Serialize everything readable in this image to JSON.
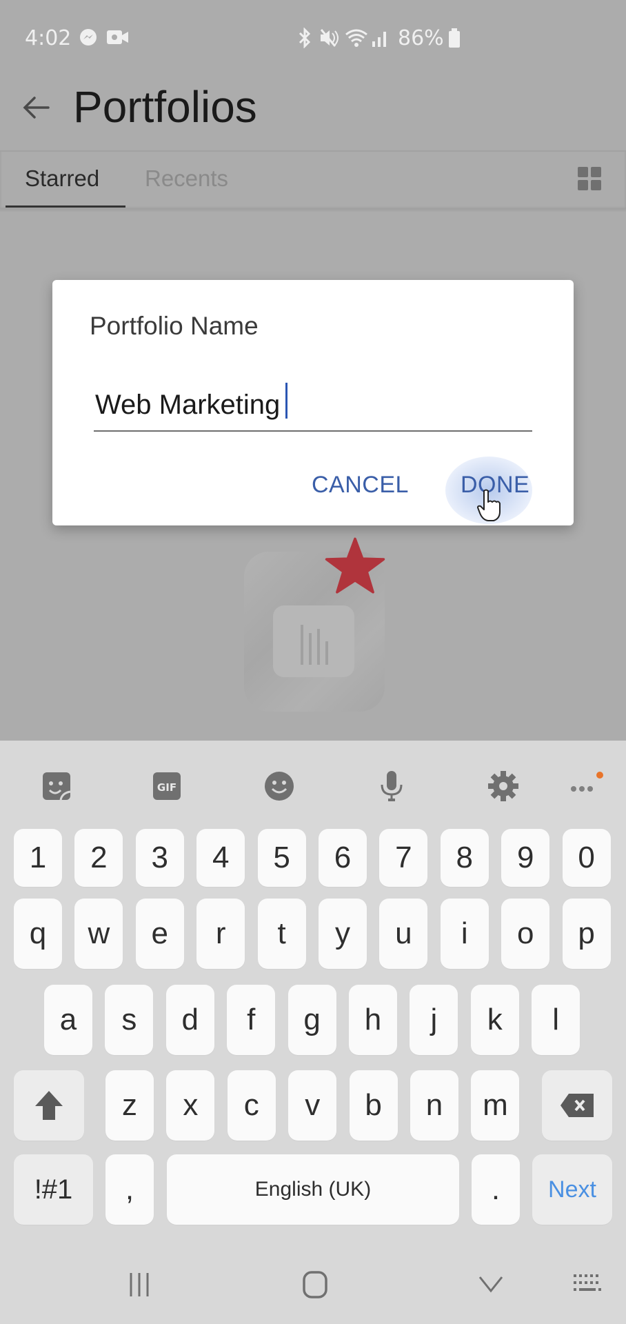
{
  "status_bar": {
    "time": "4:02",
    "battery": "86%",
    "left_icons": [
      "messenger-icon",
      "video-call-icon"
    ],
    "right_icons": [
      "bluetooth-icon",
      "mute-icon",
      "wifi-icon",
      "signal-icon",
      "battery-icon"
    ]
  },
  "app_bar": {
    "title": "Portfolios",
    "back_icon": "arrow-left-icon"
  },
  "tabs": [
    {
      "label": "Starred",
      "selected": true
    },
    {
      "label": "Recents",
      "selected": false
    }
  ],
  "view_toggle_icon": "grid-view-icon",
  "portfolio_card": {
    "starred": true,
    "star_color": "#b0343c",
    "icon": "bar-chart-icon"
  },
  "dialog": {
    "title": "Portfolio Name",
    "input_value": "Web Marketing",
    "cancel_label": "CANCEL",
    "done_label": "DONE",
    "accent_color": "#3a5ea8"
  },
  "keyboard": {
    "toolbar": [
      "sticker-icon",
      "gif-icon",
      "emoji-icon",
      "microphone-icon",
      "settings-icon",
      "more-icon"
    ],
    "rows": [
      [
        "1",
        "2",
        "3",
        "4",
        "5",
        "6",
        "7",
        "8",
        "9",
        "0"
      ],
      [
        "q",
        "w",
        "e",
        "r",
        "t",
        "y",
        "u",
        "i",
        "o",
        "p"
      ],
      [
        "a",
        "s",
        "d",
        "f",
        "g",
        "h",
        "j",
        "k",
        "l"
      ],
      [
        "z",
        "x",
        "c",
        "v",
        "b",
        "n",
        "m"
      ]
    ],
    "symbols_label": "!#1",
    "comma": ",",
    "space_label": "English (UK)",
    "period": ".",
    "action_label": "Next",
    "action_color": "#4a90e2"
  },
  "nav_bar": [
    "recents-icon",
    "home-icon",
    "back-chevron-icon",
    "keyboard-switch-icon"
  ]
}
